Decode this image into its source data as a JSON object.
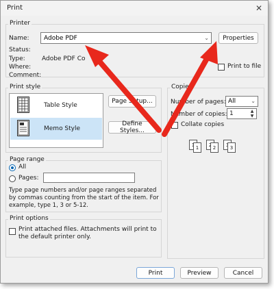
{
  "window": {
    "title": "Print",
    "close_glyph": "✕"
  },
  "printer": {
    "group_label": "Printer",
    "name_label": "Name:",
    "name_value": "Adobe PDF",
    "properties_label": "Properties",
    "status_label": "Status:",
    "status_value": "",
    "type_label": "Type:",
    "type_value": "Adobe PDF Co",
    "where_label": "Where:",
    "comment_label": "Comment:",
    "print_to_file_label": "Print to file"
  },
  "print_style": {
    "group_label": "Print style",
    "items": [
      {
        "label": "Table Style",
        "selected": false,
        "icon": "table-style-icon"
      },
      {
        "label": "Memo Style",
        "selected": true,
        "icon": "memo-style-icon"
      }
    ],
    "page_setup_label": "Page Setup...",
    "define_styles_label": "Define Styles..."
  },
  "copies": {
    "group_label": "Copies",
    "num_pages_label": "Number of pages:",
    "num_pages_value": "All",
    "num_copies_label": "Number of copies:",
    "num_copies_value": "1",
    "collate_label": "Collate copies",
    "collate_pages": [
      "1",
      "1",
      "2",
      "2",
      "3",
      "3"
    ]
  },
  "page_range": {
    "group_label": "Page range",
    "all_label": "All",
    "pages_label": "Pages:",
    "help_text": "Type page numbers and/or page ranges separated by commas counting from the start of the item.  For example, type 1, 3 or 5-12."
  },
  "print_options": {
    "group_label": "Print options",
    "attached_label": "Print attached files.  Attachments will print to the default printer only."
  },
  "footer": {
    "print_label": "Print",
    "preview_label": "Preview",
    "cancel_label": "Cancel"
  },
  "colors": {
    "annotation_arrow": "#e8281c",
    "selection": "#cce4f7",
    "accent": "#0063b1"
  }
}
